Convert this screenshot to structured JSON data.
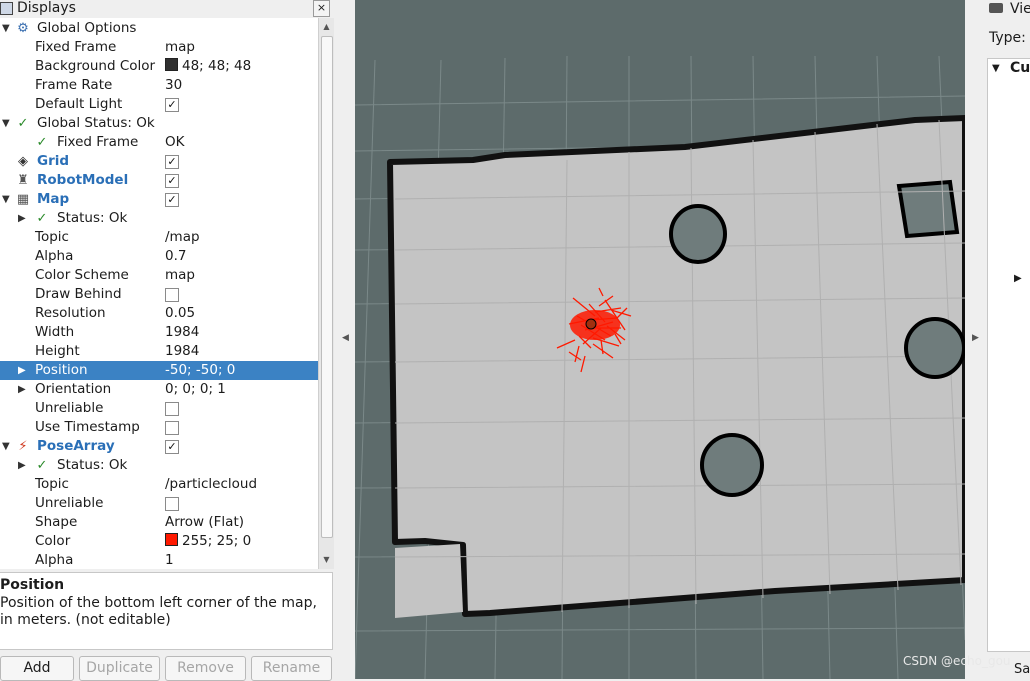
{
  "displays_panel": {
    "title": "Displays",
    "close_label": "×",
    "rows": [
      {
        "label": "Global Options",
        "expanded": true,
        "icon": "gear-icon",
        "level": 0
      },
      {
        "label": "Fixed Frame",
        "value": "map",
        "level": 1
      },
      {
        "label": "Background Color",
        "value": "48; 48; 48",
        "swatch": "#303030",
        "level": 1
      },
      {
        "label": "Frame Rate",
        "value": "30",
        "level": 1
      },
      {
        "label": "Default Light",
        "checkbox": true,
        "checked": true,
        "level": 1
      },
      {
        "label": "Global Status: Ok",
        "expanded": true,
        "icon": "checkmark-icon",
        "level": 0
      },
      {
        "label": "Fixed Frame",
        "value": "OK",
        "icon": "checkmark-icon",
        "level": 1
      },
      {
        "label": "Grid",
        "checkbox": true,
        "checked": true,
        "icon": "grid-icon",
        "blue": true,
        "level": 0
      },
      {
        "label": "RobotModel",
        "checkbox": true,
        "checked": true,
        "icon": "robot-icon",
        "blue": true,
        "level": 0
      },
      {
        "label": "Map",
        "checkbox": true,
        "checked": true,
        "icon": "map-icon",
        "blue": true,
        "expanded": true,
        "level": 0
      },
      {
        "label": "Status: Ok",
        "icon": "checkmark-icon",
        "collapsed": true,
        "level": 1
      },
      {
        "label": "Topic",
        "value": "/map",
        "level": 1
      },
      {
        "label": "Alpha",
        "value": "0.7",
        "level": 1
      },
      {
        "label": "Color Scheme",
        "value": "map",
        "level": 1
      },
      {
        "label": "Draw Behind",
        "checkbox": true,
        "checked": false,
        "level": 1
      },
      {
        "label": "Resolution",
        "value": "0.05",
        "level": 1
      },
      {
        "label": "Width",
        "value": "1984",
        "level": 1
      },
      {
        "label": "Height",
        "value": "1984",
        "level": 1
      },
      {
        "label": "Position",
        "value": "-50; -50; 0",
        "collapsed": true,
        "selected": true,
        "level": 1
      },
      {
        "label": "Orientation",
        "value": "0; 0; 0; 1",
        "collapsed": true,
        "level": 1
      },
      {
        "label": "Unreliable",
        "checkbox": true,
        "checked": false,
        "level": 1
      },
      {
        "label": "Use Timestamp",
        "checkbox": true,
        "checked": false,
        "level": 1
      },
      {
        "label": "PoseArray",
        "checkbox": true,
        "checked": true,
        "icon": "posearray-icon",
        "blue": true,
        "expanded": true,
        "level": 0
      },
      {
        "label": "Status: Ok",
        "icon": "checkmark-icon",
        "collapsed": true,
        "level": 1
      },
      {
        "label": "Topic",
        "value": "/particlecloud",
        "level": 1
      },
      {
        "label": "Unreliable",
        "checkbox": true,
        "checked": false,
        "level": 1
      },
      {
        "label": "Shape",
        "value": "Arrow (Flat)",
        "level": 1
      },
      {
        "label": "Color",
        "value": "255; 25; 0",
        "swatch": "#ff1900",
        "level": 1
      },
      {
        "label": "Alpha",
        "value": "1",
        "level": 1
      }
    ],
    "description": {
      "heading": "Position",
      "text": "Position of the bottom left corner of the map, in meters. (not editable)"
    },
    "buttons": [
      {
        "label": "Add",
        "enabled": true
      },
      {
        "label": "Duplicate",
        "enabled": false
      },
      {
        "label": "Remove",
        "enabled": false
      },
      {
        "label": "Rename",
        "enabled": false
      }
    ]
  },
  "views_panel": {
    "title": "Vie",
    "type_label": "Type:",
    "current_label": "Cu",
    "save_label": "Sa"
  },
  "watermark": "CSDN @echo_gou",
  "colors": {
    "selection": "#3b82c4",
    "display_name_blue": "#2a6fb7",
    "view_background": "#5d6b6b",
    "map_free": "#c4c4c4",
    "particles": "#ff1900"
  }
}
